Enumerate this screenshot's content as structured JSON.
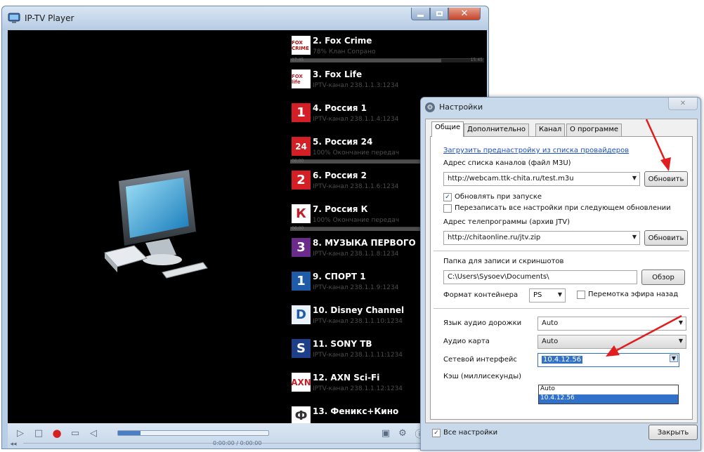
{
  "player": {
    "title": "IP-TV Player",
    "channels": [
      {
        "name": "2. Fox Crime",
        "sub": "78% Клан Сопрано",
        "logo": "FOX CRIME",
        "logo_color": "#ffffff",
        "logo_text_color": "#b01010",
        "progress": 0.78,
        "time_start": "07:45",
        "time_end": "15:45"
      },
      {
        "name": "3. Fox Life",
        "sub": "IPTV-канал 238.1.1.3:1234",
        "logo": "FOX life",
        "logo_color": "#ffffff",
        "logo_text_color": "#c0202a"
      },
      {
        "name": "4. Россия 1",
        "sub": "IPTV-канал 238.1.1.4:1234",
        "logo": "1",
        "logo_color": "#d51f26",
        "logo_text_color": "#ffffff"
      },
      {
        "name": "5. Россия 24",
        "sub": "100% Окончание передач",
        "logo": "24",
        "logo_color": "#d51f26",
        "logo_text_color": "#ffffff",
        "progress": 1.0,
        "time_start": "06:00"
      },
      {
        "name": "6. Россия 2",
        "sub": "IPTV-канал 238.1.1.6:1234",
        "logo": "2",
        "logo_color": "#d51f26",
        "logo_text_color": "#ffffff"
      },
      {
        "name": "7. Россия К",
        "sub": "100% Окончание передач",
        "logo": "К",
        "logo_color": "#ffffff",
        "logo_text_color": "#c0202a",
        "progress": 1.0,
        "time_start": "06:00"
      },
      {
        "name": "8. МУЗЫКА ПЕРВОГО",
        "sub": "IPTV-канал 238.1.1.8:1234",
        "logo": "3",
        "logo_color": "#6a2b8a",
        "logo_text_color": "#ffffff"
      },
      {
        "name": "9. СПОРТ 1",
        "sub": "IPTV-канал 238.1.1.9:1234",
        "logo": "1",
        "logo_color": "#1e5ca8",
        "logo_text_color": "#ffffff"
      },
      {
        "name": "10. Disney Channel",
        "sub": "IPTV-канал 238.1.1.10:1234",
        "logo": "D",
        "logo_color": "#e9f1fb",
        "logo_text_color": "#1e5ca8"
      },
      {
        "name": "11. SONY TB",
        "sub": "IPTV-канал 238.1.1.11:1234",
        "logo": "S",
        "logo_color": "#1d3f8a",
        "logo_text_color": "#ffffff"
      },
      {
        "name": "12. AXN Sci-Fi",
        "sub": "IPTV-канал 238.1.1.12:1234",
        "logo": "AXN",
        "logo_color": "#ffffff",
        "logo_text_color": "#c0202a"
      },
      {
        "name": "13. Феникс+Кино",
        "sub": "",
        "logo": "Ф",
        "logo_color": "#ffffff",
        "logo_text_color": "#333333"
      }
    ],
    "time": "0:00:00 / 0:00:00",
    "volume": 0.15
  },
  "settings": {
    "title": "Настройки",
    "tabs": [
      "Общие",
      "Дополнительно",
      "Канал",
      "О программе"
    ],
    "preset_link": "Загрузить преднастройку из списка провайдеров",
    "m3u_label": "Адрес списка каналов (файл M3U)",
    "m3u_value": "http://webcam.ttk-chita.ru/test.m3u",
    "update_button": "Обновить",
    "update_on_start": "Обновлять при запуске",
    "rewrite_all": "Перезаписать все настройки при следующем обновлении",
    "jtv_label": "Адрес телепрограммы (архив JTV)",
    "jtv_value": "http://chitaonline.ru/jtv.zip",
    "update_button2": "Обновить",
    "folder_label": "Папка для записи и скриншотов",
    "folder_value": "C:\\Users\\Sysoev\\Documents\\",
    "browse_button": "Обзор",
    "container_label": "Формат контейнера",
    "container_value": "PS",
    "timeshift": "Перемотка эфира назад",
    "audio_track_label": "Язык аудио дорожки",
    "audio_track_value": "Auto",
    "audio_card_label": "Аудио карта",
    "audio_card_value": "Auto",
    "net_iface_label": "Сетевой интерфейс",
    "net_iface_value": "10.4.12.56",
    "net_iface_options": [
      "Auto",
      "10.4.12.56"
    ],
    "cache_label": "Кэш (миллисекунды)",
    "all_settings": "Все настройки",
    "close_button": "Закрыть"
  }
}
